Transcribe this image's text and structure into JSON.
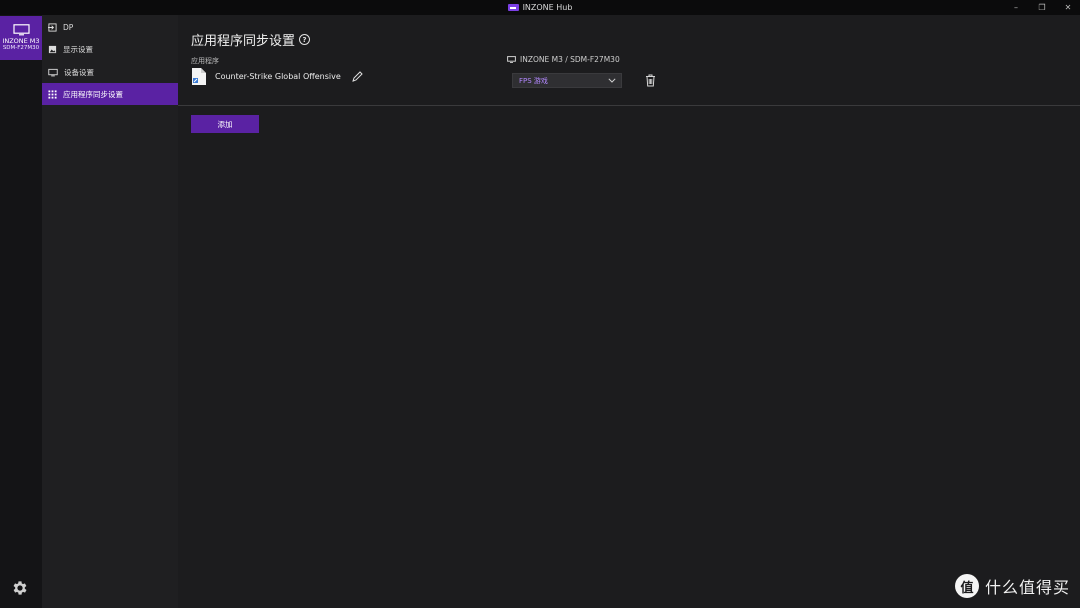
{
  "window": {
    "title": "INZONE Hub",
    "controls": {
      "minimize": "–",
      "maximize": "❐",
      "close": "✕"
    }
  },
  "device": {
    "name": "INZONE M3",
    "model": "SDM-F27M30"
  },
  "sidebar": {
    "items": [
      {
        "label": "DP",
        "icon": "input-icon"
      },
      {
        "label": "显示设置",
        "icon": "image-icon"
      },
      {
        "label": "设备设置",
        "icon": "monitor-icon"
      },
      {
        "label": "应用程序同步设置",
        "icon": "grid-icon",
        "active": true
      }
    ]
  },
  "main": {
    "title": "应用程序同步设置",
    "help_symbol": "?",
    "app_column_label": "应用程序",
    "monitor_column_label": "INZONE M3 / SDM-F27M30",
    "rows": [
      {
        "app_name": "Counter-Strike Global Offensive",
        "mode": "FPS 游戏"
      }
    ],
    "add_button": "添加"
  },
  "watermark": {
    "logo_char": "值",
    "text": "什么值得买"
  },
  "colors": {
    "accent": "#5a22a3",
    "accent_text": "#b388ff",
    "background": "#1c1c1e"
  }
}
